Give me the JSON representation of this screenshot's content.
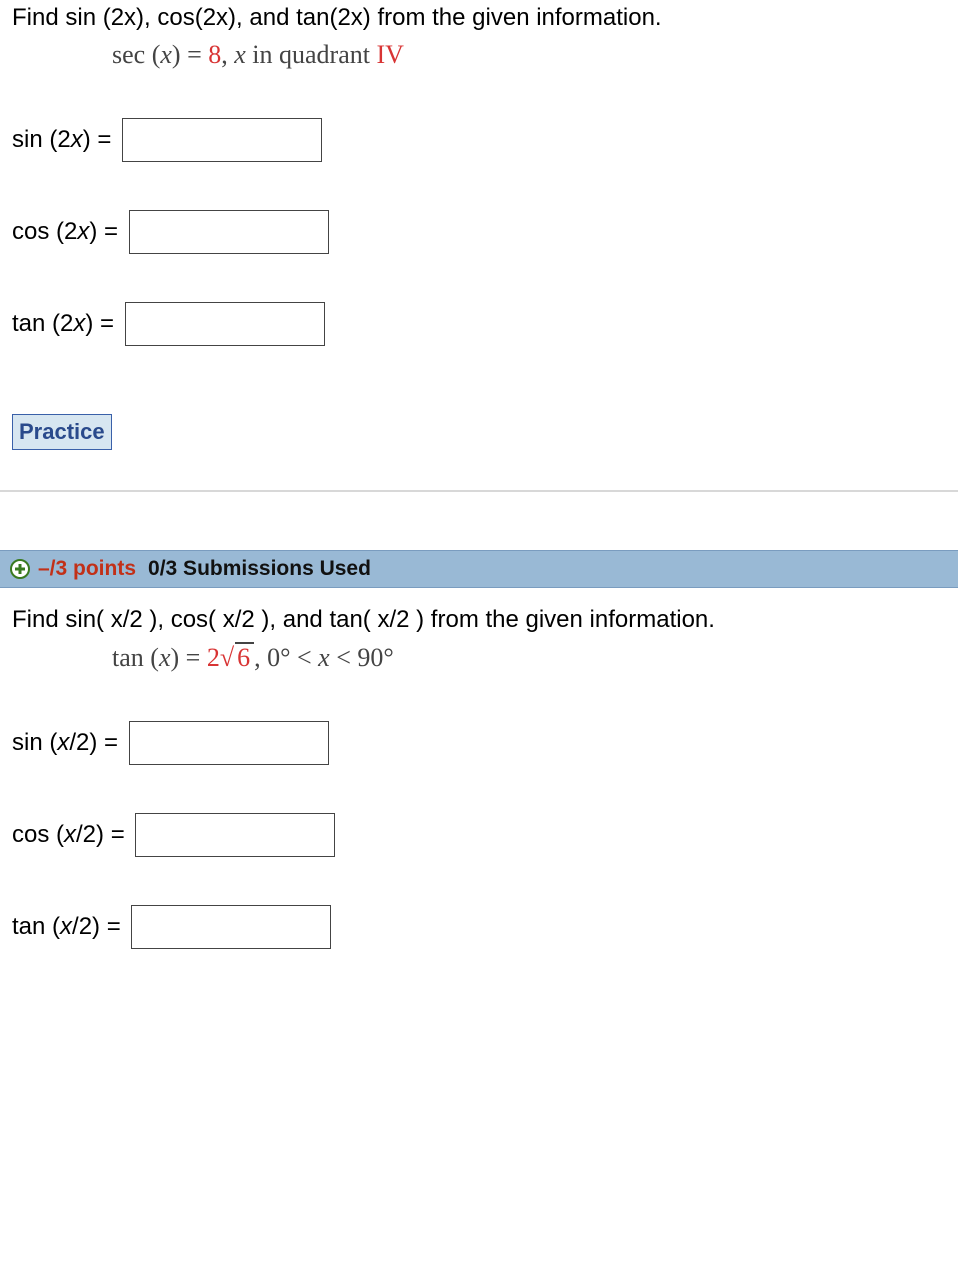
{
  "problem1": {
    "prompt": "Find sin (2x), cos(2x), and tan(2x) from the given information.",
    "given_func": "sec",
    "given_arg_pre": " (",
    "given_arg_var": "x",
    "given_arg_post": ") = ",
    "given_value": "8",
    "given_text1": ",    ",
    "quadrant_var": "x",
    "quadrant_text": " in quadrant ",
    "quadrant_num": "IV",
    "rows": [
      {
        "label_pre": "sin (2",
        "label_var": "x",
        "label_post": ") = "
      },
      {
        "label_pre": "cos (2",
        "label_var": "x",
        "label_post": ") = "
      },
      {
        "label_pre": "tan (2",
        "label_var": "x",
        "label_post": ") = "
      }
    ],
    "practice_label": "Practice"
  },
  "header": {
    "points": "–/3 points",
    "submissions": "0/3 Submissions Used"
  },
  "problem2": {
    "prompt": "Find sin( x/2 ), cos( x/2 ), and tan( x/2 ) from the given information.",
    "given_func": "tan",
    "given_arg_pre": " (",
    "given_arg_var": "x",
    "given_arg_post": ") = ",
    "given_value_pre": "2",
    "given_radicand": "6",
    "given_text1": ",    ",
    "range_pre": "0° < ",
    "range_var": "x",
    "range_post": " < 90°",
    "rows": [
      {
        "label_pre": "sin (",
        "label_var": "x",
        "label_post": "/2) = "
      },
      {
        "label_pre": "cos (",
        "label_var": "x",
        "label_post": "/2) = "
      },
      {
        "label_pre": "tan (",
        "label_var": "x",
        "label_post": "/2) = "
      }
    ]
  }
}
